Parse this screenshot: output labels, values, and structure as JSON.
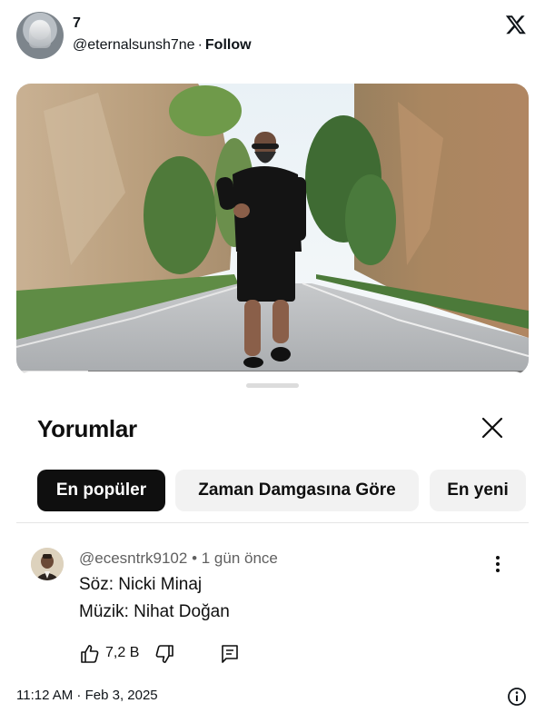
{
  "tweet": {
    "display_name": "7",
    "handle": "@eternalsunsh7ne",
    "separator": "·",
    "follow_label": "Follow",
    "avatar_icon": "user-avatar",
    "logo_icon": "x-logo-icon"
  },
  "video_player": {
    "progress": 0.14,
    "progress_color": "#e0e0e0"
  },
  "comments_sheet": {
    "title": "Yorumlar",
    "close_icon": "close-icon",
    "filters": [
      {
        "label": "En popüler",
        "selected": true
      },
      {
        "label": "Zaman Damgasına Göre",
        "selected": false
      },
      {
        "label": "En yeni",
        "selected": false
      }
    ],
    "comment": {
      "author": "@ecesntrk9102",
      "time": "1 gün önce",
      "lines": [
        "Söz: Nicki Minaj",
        "Müzik: Nihat Doğan"
      ],
      "like_count": "7,2 B",
      "icons": [
        "thumbs-up-icon",
        "thumbs-down-icon",
        "reply-icon",
        "more-vert-icon"
      ]
    }
  },
  "footer": {
    "timestamp": "11:12 AM · Feb 3, 2025",
    "info_icon": "info-icon"
  },
  "colors": {
    "chip_selected_bg": "#0f0f0f",
    "chip_bg": "#f2f2f2",
    "meta_text": "#606060"
  }
}
